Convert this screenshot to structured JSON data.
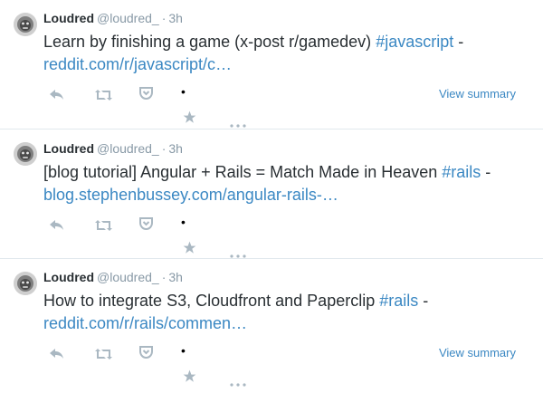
{
  "tweets": [
    {
      "name": "Loudred",
      "handle": "@loudred_",
      "separator": "·",
      "time": "3h",
      "text": "Learn by finishing a game (x-post r/gamedev) ",
      "hashtag": "#javascript",
      "after_hashtag": " -",
      "link": "reddit.com/r/javascript/c…",
      "summary_label": "View summary",
      "bullet": "•"
    },
    {
      "name": "Loudred",
      "handle": "@loudred_",
      "separator": "·",
      "time": "3h",
      "text": "[blog tutorial] Angular + Rails = Match Made in Heaven ",
      "hashtag": "#rails",
      "after_hashtag": " -",
      "link": "blog.stephenbussey.com/angular-rails-…",
      "bullet": "•"
    },
    {
      "name": "Loudred",
      "handle": "@loudred_",
      "separator": "·",
      "time": "3h",
      "text": "How to integrate S3, Cloudfront and Paperclip ",
      "hashtag": "#rails",
      "after_hashtag": " -",
      "link": "reddit.com/r/rails/commen…",
      "summary_label": "View summary",
      "bullet": "•"
    }
  ],
  "icons": {
    "reply": "reply-icon",
    "retweet": "retweet-icon",
    "pocket": "pocket-icon",
    "favorite": "star-icon",
    "more": "more-dots-icon"
  },
  "colors": {
    "text": "#292f33",
    "muted": "#8899a6",
    "link": "#3b88c3",
    "icon": "#aab8c2",
    "divider": "#e1e8ed"
  }
}
